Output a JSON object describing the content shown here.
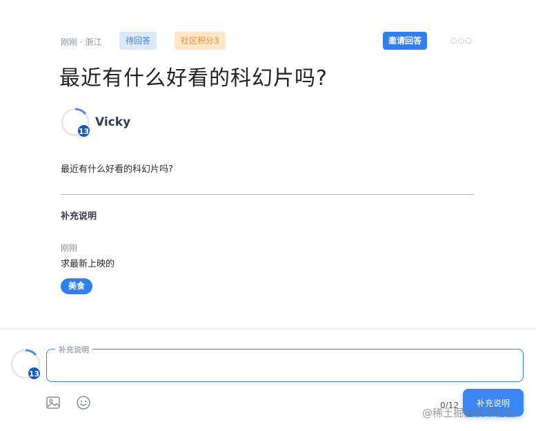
{
  "question": {
    "time_location": "刚刚 · 浙江",
    "status_badge": "待回答",
    "points_badge": "社区积分3",
    "invite_label": "邀请回答",
    "more_label": "○○○",
    "title": "最近有什么好看的科幻片吗?",
    "body": "最近有什么好看的科幻片吗?"
  },
  "author": {
    "name": "Vicky",
    "level": "13"
  },
  "supplement": {
    "heading": "补充说明",
    "time": "刚刚",
    "text": "求最新上映的",
    "tag": "美食"
  },
  "composer": {
    "level": "13",
    "legend": "补充说明",
    "value": "",
    "counter": "0/12",
    "submit_label": "补充说明",
    "tools": [
      "image-icon",
      "emoji-icon"
    ]
  },
  "watermark": "@稀土掘金技术社区",
  "colors": {
    "accent": "#2f7ff3",
    "level_badge": "#1258c9",
    "pending_bg": "#dce9fb",
    "points_bg": "#fde7c8",
    "points_text": "#ef8f2a"
  }
}
